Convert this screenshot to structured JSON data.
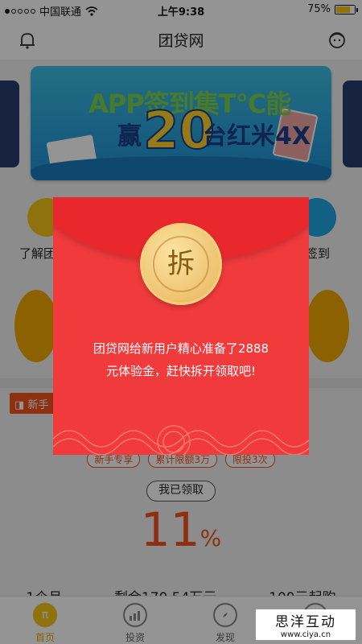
{
  "status_bar": {
    "carrier": "中国联通",
    "time": "上午9:38",
    "battery": "75%"
  },
  "header": {
    "title": "团贷网"
  },
  "banner": {
    "line1": "APP签到集T℃能",
    "line2_pre": "赢",
    "line2_num": "20",
    "line2_post": "台红米4X"
  },
  "quick_links": [
    {
      "label": "了解团"
    },
    {
      "label": "签到"
    }
  ],
  "product": {
    "newbie_label": "新手",
    "tags": [
      "新手专享",
      "累计限额3万",
      "限投3次"
    ],
    "claimed_label": "我已领取",
    "rate_value": "11",
    "rate_unit": "%",
    "term": "1个月",
    "remaining": "剩余170.54万元",
    "min_invest": "100元起购"
  },
  "bottom_nav": [
    {
      "label": "首页",
      "icon": "pi-icon",
      "active": true
    },
    {
      "label": "投资",
      "icon": "chart-icon",
      "active": false
    },
    {
      "label": "发现",
      "icon": "compass-icon",
      "active": false
    },
    {
      "label": "",
      "icon": "user-icon",
      "active": false
    }
  ],
  "red_envelope": {
    "seal_char": "拆",
    "message_line1": "团贷网给新用户精心准备了2888",
    "message_line2": "元体验金，赶快拆开领取吧!"
  },
  "watermark": {
    "title": "思洋互动",
    "url": "www.ciya.cn"
  },
  "colors": {
    "accent": "#f2541e",
    "envelope": "#f03a3c",
    "seal": "#e9b45c",
    "brand_yellow": "#f5c518"
  }
}
